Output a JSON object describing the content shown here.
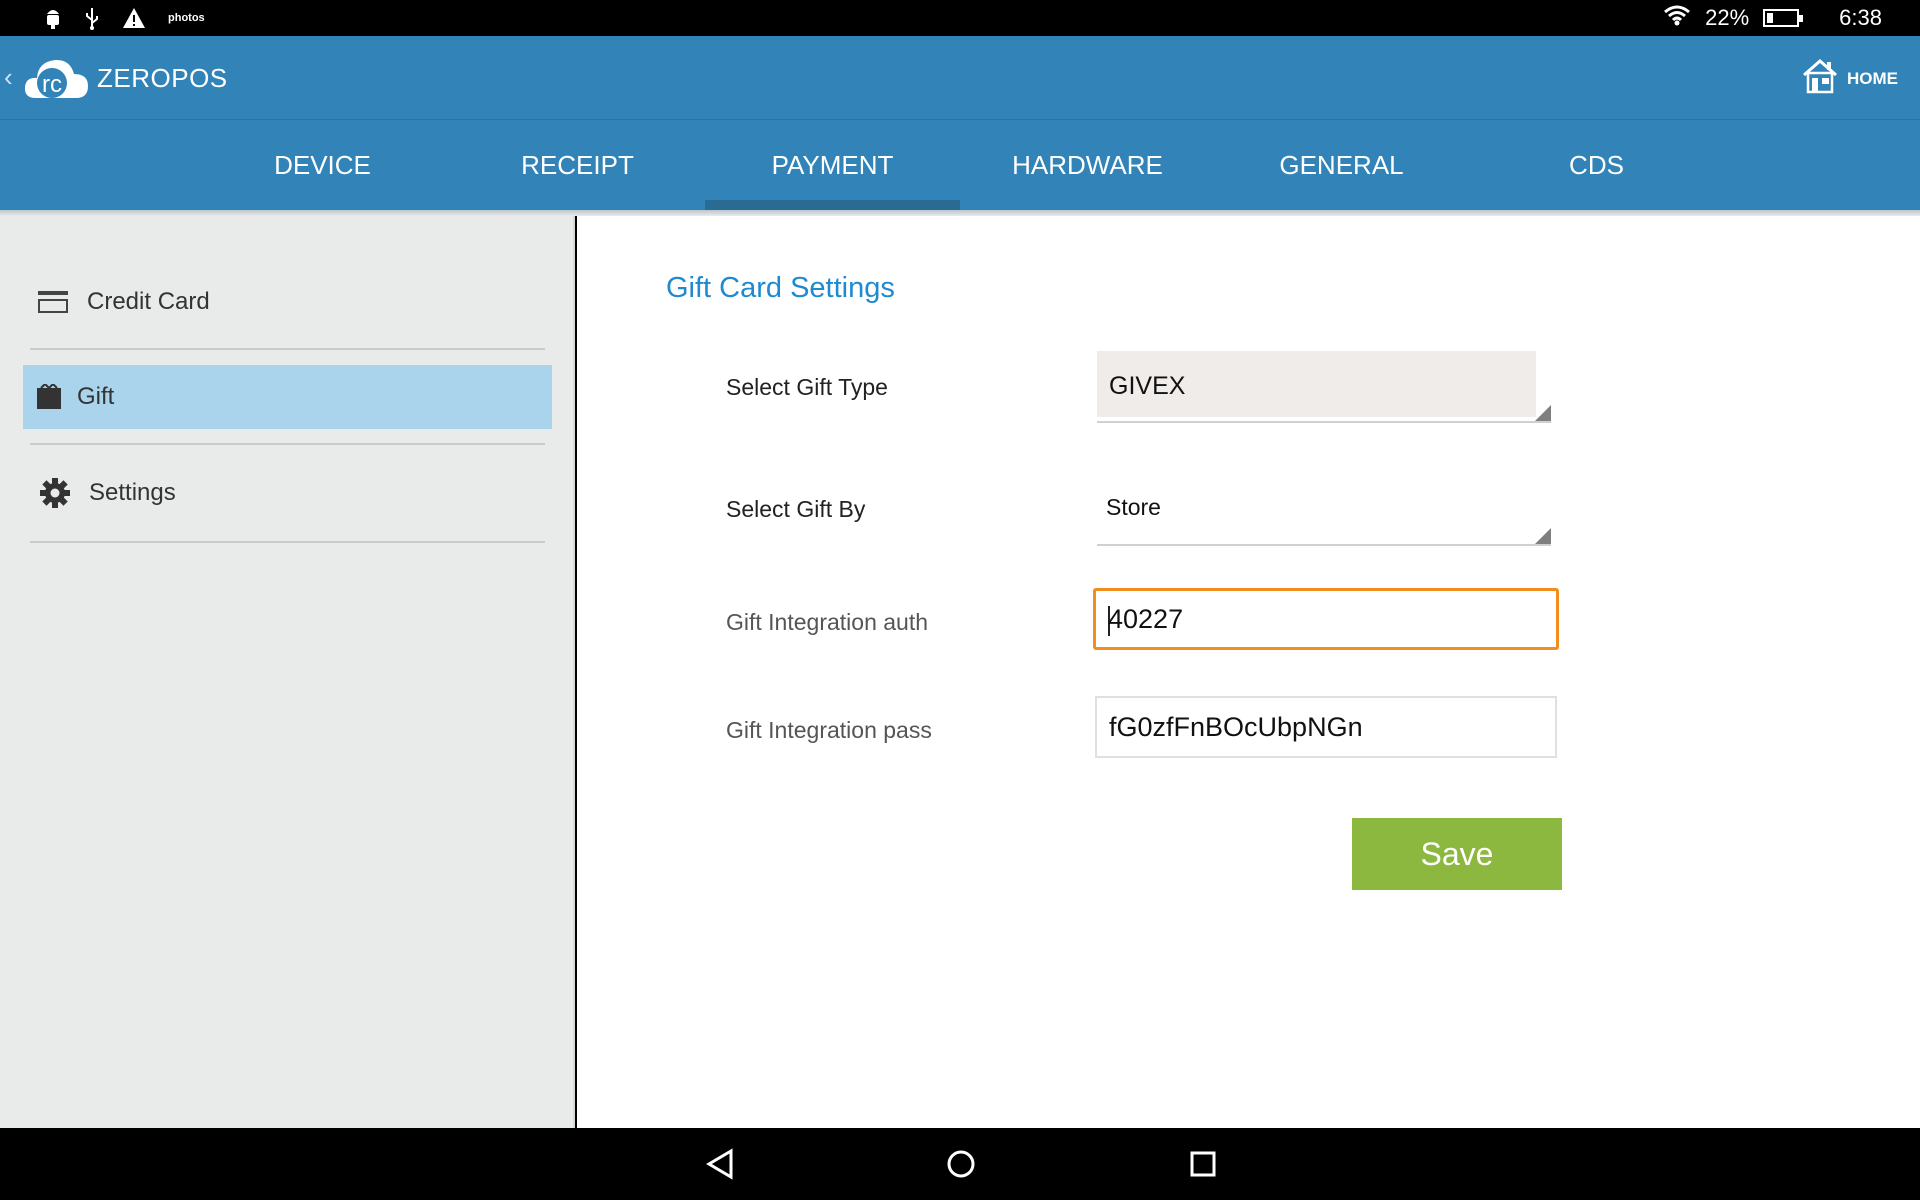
{
  "status_bar": {
    "left_icons": [
      "android-icon",
      "usb-icon",
      "warning-icon",
      "photos-icon"
    ],
    "photos_label": "photos",
    "battery": "22%",
    "battery_level": 0.22,
    "time": "6:38"
  },
  "app_bar": {
    "logo_text": "rc",
    "title": "ZEROPOS",
    "home_label": "HOME"
  },
  "tabs": [
    {
      "label": "DEVICE"
    },
    {
      "label": "RECEIPT"
    },
    {
      "label": "PAYMENT",
      "active": true
    },
    {
      "label": "HARDWARE"
    },
    {
      "label": "GENERAL"
    },
    {
      "label": "CDS"
    }
  ],
  "sidebar": {
    "items": [
      {
        "label": "Credit Card",
        "icon": "credit-card-icon"
      },
      {
        "label": "Gift",
        "icon": "gift-icon",
        "active": true
      },
      {
        "label": "Settings",
        "icon": "gear-icon"
      }
    ]
  },
  "gift_settings": {
    "title": "Gift Card Settings",
    "gift_type_label": "Select Gift Type",
    "gift_type_value": "GIVEX",
    "gift_by_label": "Select Gift By",
    "gift_by_value": "Store",
    "auth_label": "Gift Integration auth",
    "auth_value": "40227",
    "pass_label": "Gift Integration pass",
    "pass_value": "fG0zfFnBOcUbpNGn",
    "save_label": "Save"
  },
  "colors": {
    "app_blue": "#3183b8",
    "accent_title": "#1f8ad0",
    "sidebar_active": "#a9d4ec",
    "focus_orange": "#f28e1e",
    "save_green": "#8db840"
  }
}
